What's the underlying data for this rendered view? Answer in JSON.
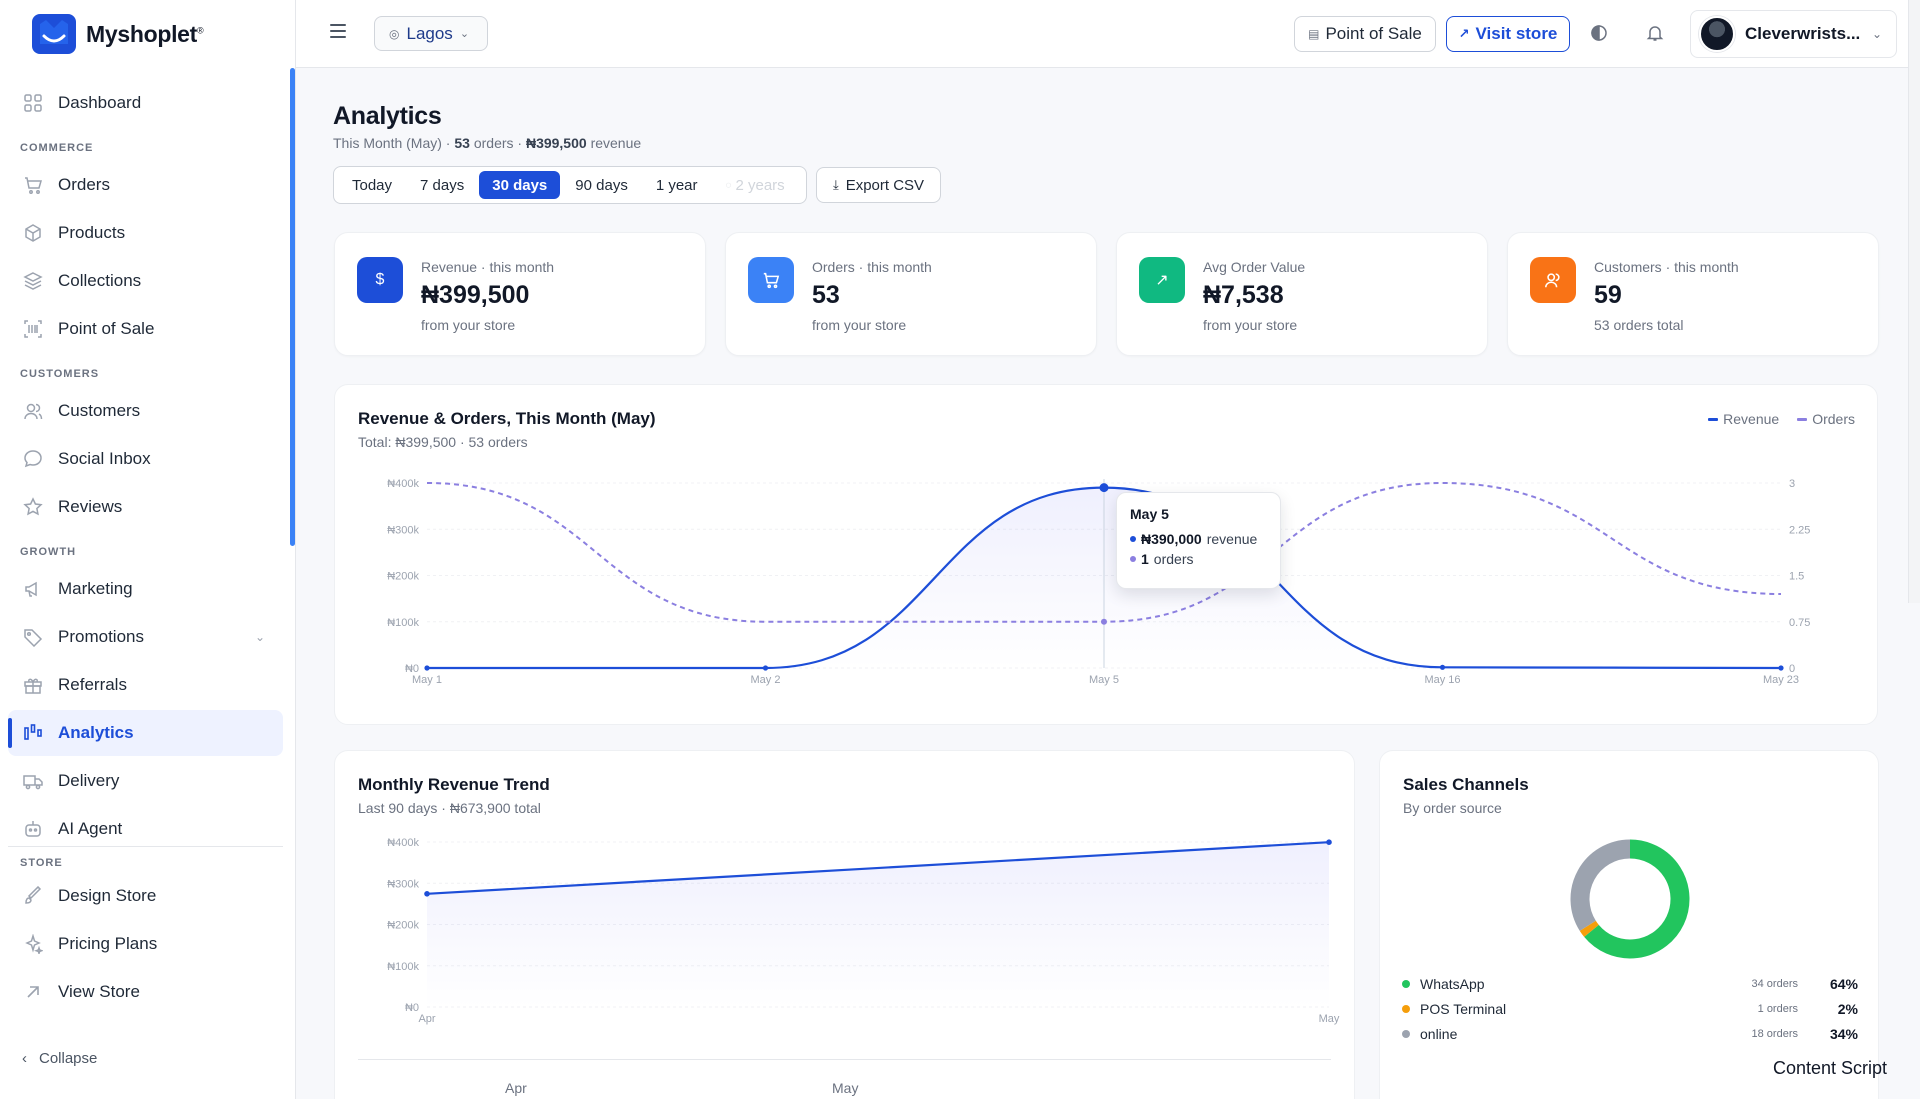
{
  "brand": {
    "name": "Myshoplet",
    "mark": "®"
  },
  "sidebar": {
    "dashboard": "Dashboard",
    "sections": {
      "commerce": "COMMERCE",
      "customers": "CUSTOMERS",
      "growth": "GROWTH",
      "store": "STORE"
    },
    "commerce": [
      "Orders",
      "Products",
      "Collections",
      "Point of Sale"
    ],
    "customers": [
      "Customers",
      "Social Inbox",
      "Reviews"
    ],
    "growth": [
      "Marketing",
      "Promotions",
      "Referrals",
      "Analytics",
      "Delivery",
      "AI Agent"
    ],
    "store": [
      "Design Store",
      "Pricing Plans",
      "View Store"
    ],
    "active": "Analytics",
    "collapse": "Collapse"
  },
  "header": {
    "location": "Lagos",
    "pos_button": "Point of Sale",
    "visit_button": "Visit store",
    "user_name": "Cleverwrists..."
  },
  "page": {
    "title": "Analytics",
    "subtitle_period": "This Month (May) ·",
    "subtitle_orders": "53",
    "subtitle_orders_suffix": "orders ·",
    "subtitle_revenue": "₦399,500",
    "subtitle_revenue_suffix": "revenue",
    "ranges": [
      "Today",
      "7 days",
      "30 days",
      "90 days",
      "1 year",
      "2 years"
    ],
    "active_range": "30 days",
    "export_button": "Export CSV"
  },
  "stats": [
    {
      "label": "Revenue · this month",
      "value": "₦399,500",
      "foot": "from your store",
      "icon": "dollar-icon",
      "color": "#1d4ed8"
    },
    {
      "label": "Orders · this month",
      "value": "53",
      "foot": "from your store",
      "icon": "cart-icon",
      "color": "#3b82f6"
    },
    {
      "label": "Avg Order Value",
      "value": "₦7,538",
      "foot": "from your store",
      "icon": "trend-arrow-icon",
      "color": "#10b981"
    },
    {
      "label": "Customers · this month",
      "value": "59",
      "foot": "53 orders total",
      "icon": "users-icon",
      "color": "#f97316"
    }
  ],
  "revenue_chart": {
    "title": "Revenue & Orders, This Month (May)",
    "subtitle": "Total: ₦399,500 · 53 orders",
    "legend": [
      "Revenue",
      "Orders"
    ],
    "tooltip": {
      "date": "May 5",
      "revenue": "₦390,000",
      "revenue_suffix": "revenue",
      "orders": "1",
      "orders_suffix": "orders"
    }
  },
  "monthly_chart": {
    "title": "Monthly Revenue Trend",
    "subtitle": "Last 90 days · ₦673,900 total",
    "bottom_labels": [
      "Apr",
      "May"
    ]
  },
  "channels": {
    "title": "Sales Channels",
    "subtitle": "By order source",
    "items": [
      {
        "name": "WhatsApp",
        "orders": "34 orders",
        "pct": "64%",
        "color": "#22c55e"
      },
      {
        "name": "POS Terminal",
        "orders": "1 orders",
        "pct": "2%",
        "color": "#f59e0b"
      },
      {
        "name": "online",
        "orders": "18 orders",
        "pct": "34%",
        "color": "#9ca3af"
      }
    ]
  },
  "footer_text": "Content Script",
  "chart_data": [
    {
      "type": "line",
      "title": "Revenue & Orders, This Month (May)",
      "categories": [
        "May 1",
        "May 2",
        "May 5",
        "May 16",
        "May 23"
      ],
      "series": [
        {
          "name": "Revenue",
          "axis": "left",
          "values": [
            0,
            0,
            390000,
            1500,
            0
          ],
          "color": "#1d4ed8"
        },
        {
          "name": "Orders",
          "axis": "right",
          "values": [
            3,
            0.75,
            0.75,
            3,
            1.2
          ],
          "color": "#8b7fe0"
        }
      ],
      "y_left_ticks": [
        "₦0",
        "₦100k",
        "₦200k",
        "₦300k",
        "₦400k"
      ],
      "y_left_values": [
        0,
        100000,
        200000,
        300000,
        400000
      ],
      "y_right_ticks": [
        "0",
        "0.75",
        "1.5",
        "2.25",
        "3"
      ],
      "y_right_values": [
        0,
        0.75,
        1.5,
        2.25,
        3
      ],
      "ylim_left": [
        0,
        400000
      ],
      "ylim_right": [
        0,
        3
      ]
    },
    {
      "type": "area",
      "title": "Monthly Revenue Trend",
      "categories": [
        "Apr",
        "May"
      ],
      "series": [
        {
          "name": "Revenue",
          "values": [
            274400,
            399500
          ],
          "color": "#1d4ed8"
        }
      ],
      "y_ticks": [
        "₦0",
        "₦100k",
        "₦200k",
        "₦300k",
        "₦400k"
      ],
      "y_values": [
        0,
        100000,
        200000,
        300000,
        400000
      ],
      "ylim": [
        0,
        400000
      ]
    },
    {
      "type": "pie",
      "title": "Sales Channels",
      "categories": [
        "WhatsApp",
        "POS Terminal",
        "online"
      ],
      "values": [
        64,
        2,
        34
      ]
    }
  ]
}
